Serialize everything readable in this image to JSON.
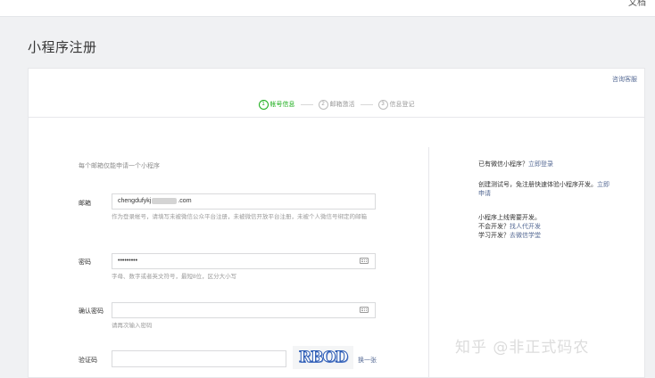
{
  "topbar": {
    "left_mark": "'",
    "doc_link": "文档"
  },
  "page_title": "小程序注册",
  "consult_link": "咨询客服",
  "steps": [
    {
      "num": "1",
      "label": "帐号信息",
      "active": true
    },
    {
      "num": "2",
      "label": "邮箱激活",
      "active": false
    },
    {
      "num": "3",
      "label": "信息登记",
      "active": false
    }
  ],
  "form": {
    "intro_hint": "每个邮箱仅能申请一个小程序",
    "email": {
      "label": "邮箱",
      "value_prefix": "chengdufykj",
      "value_suffix": ".com",
      "help": "作为登录帐号，请填写未被微信公众平台注册，未被微信开放平台注册，未被个人微信号绑定的邮箱"
    },
    "password": {
      "label": "密码",
      "value": "•••••••••",
      "help": "字母、数字或者英文符号，最短8位，区分大小写"
    },
    "confirm_password": {
      "label": "确认密码",
      "value": "",
      "help": "请再次输入密码"
    },
    "captcha": {
      "label": "验证码",
      "value": "",
      "image_text": "RBOD",
      "change_label": "换一张"
    }
  },
  "side": {
    "has_account_text": "已有微信小程序？",
    "login_link": "立即登录",
    "test_text": "创建测试号，免注册快速体验小程序开发。",
    "apply_link": "立即申请",
    "dev_line1": "小程序上线需要开发。",
    "no_dev_text": "不会开发？",
    "find_dev_link": "找人代开发",
    "learn_text": "学习开发？",
    "school_link": "去微信学堂"
  },
  "watermark": "知乎 @非正式码农",
  "colors": {
    "accent_green": "#1aad19",
    "link_blue": "#576b95",
    "border": "#d9dadc"
  }
}
